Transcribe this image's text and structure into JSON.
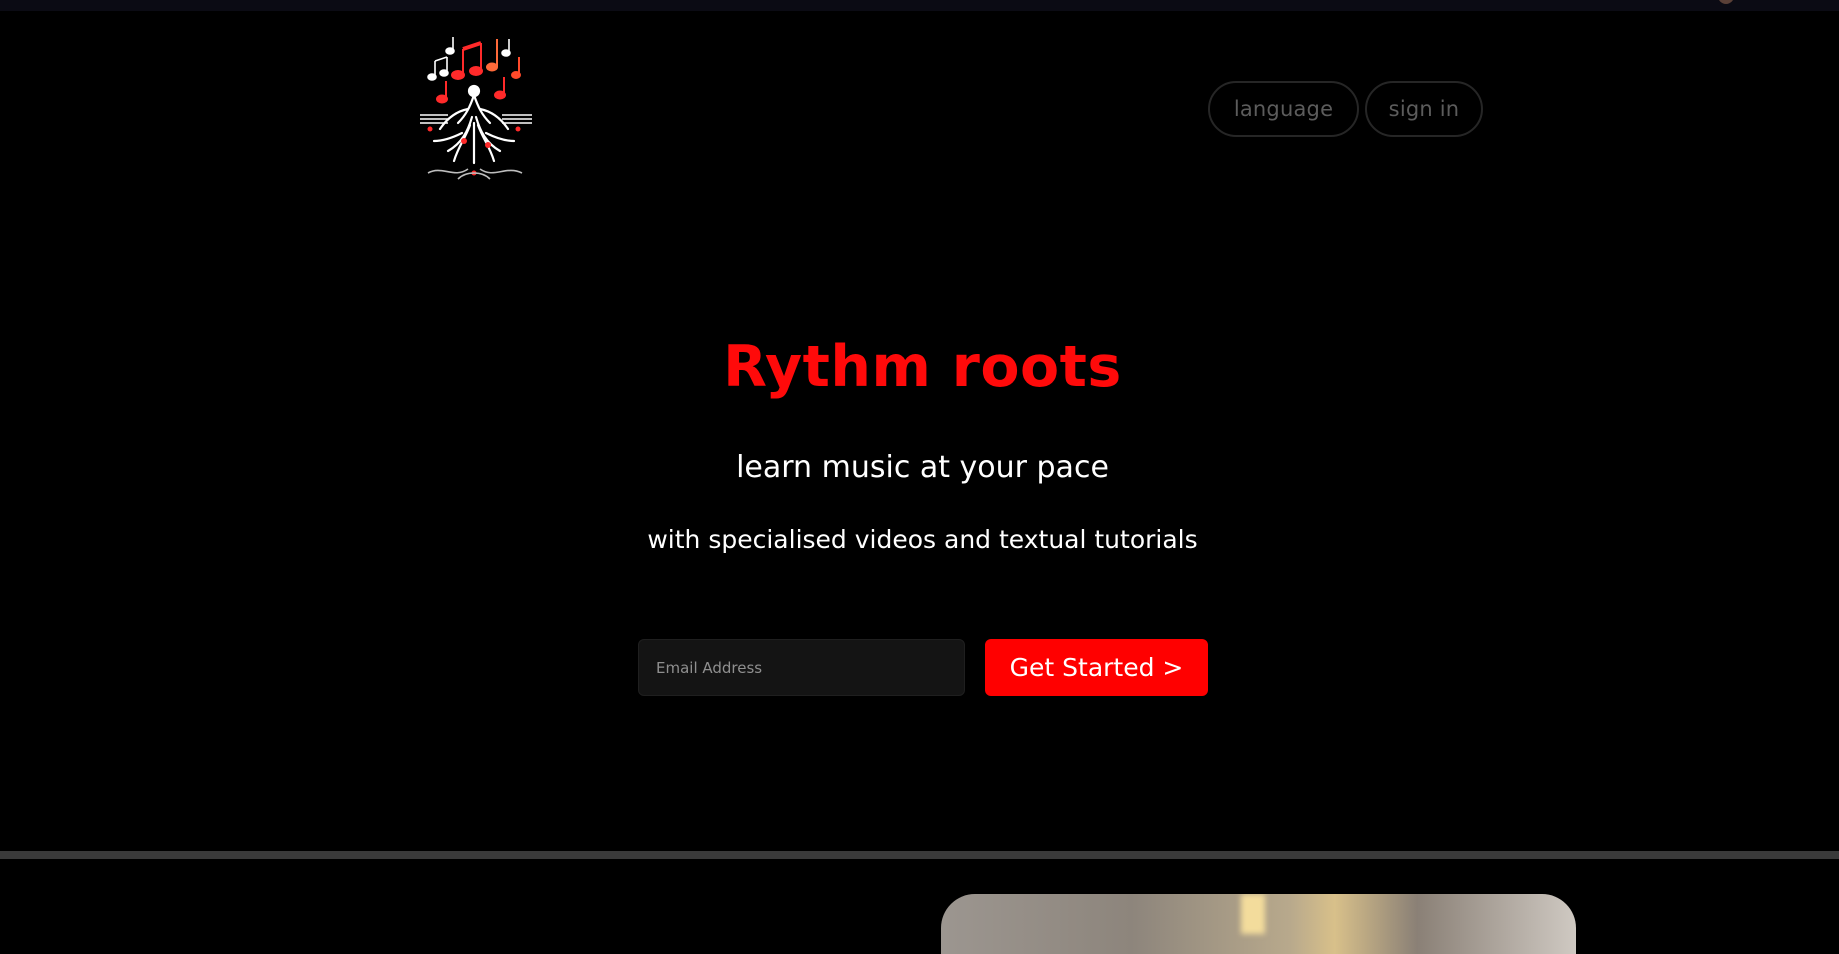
{
  "app": {
    "name": "Rythm roots",
    "logo_icon": "music-tree-logo-icon"
  },
  "header": {
    "language_label": "language",
    "signin_label": "sign in"
  },
  "hero": {
    "title": "Rythm roots",
    "subtitle": "learn music at your pace",
    "tagline": "with specialised videos and textual tutorials"
  },
  "signup": {
    "email_placeholder": "Email Address",
    "email_value": "",
    "cta_label": "Get Started >"
  },
  "colors": {
    "background": "#000000",
    "accent": "#ff0000",
    "title": "#ff0a0a",
    "nav_text": "#5c5c5c",
    "divider": "#3a3a3a"
  }
}
